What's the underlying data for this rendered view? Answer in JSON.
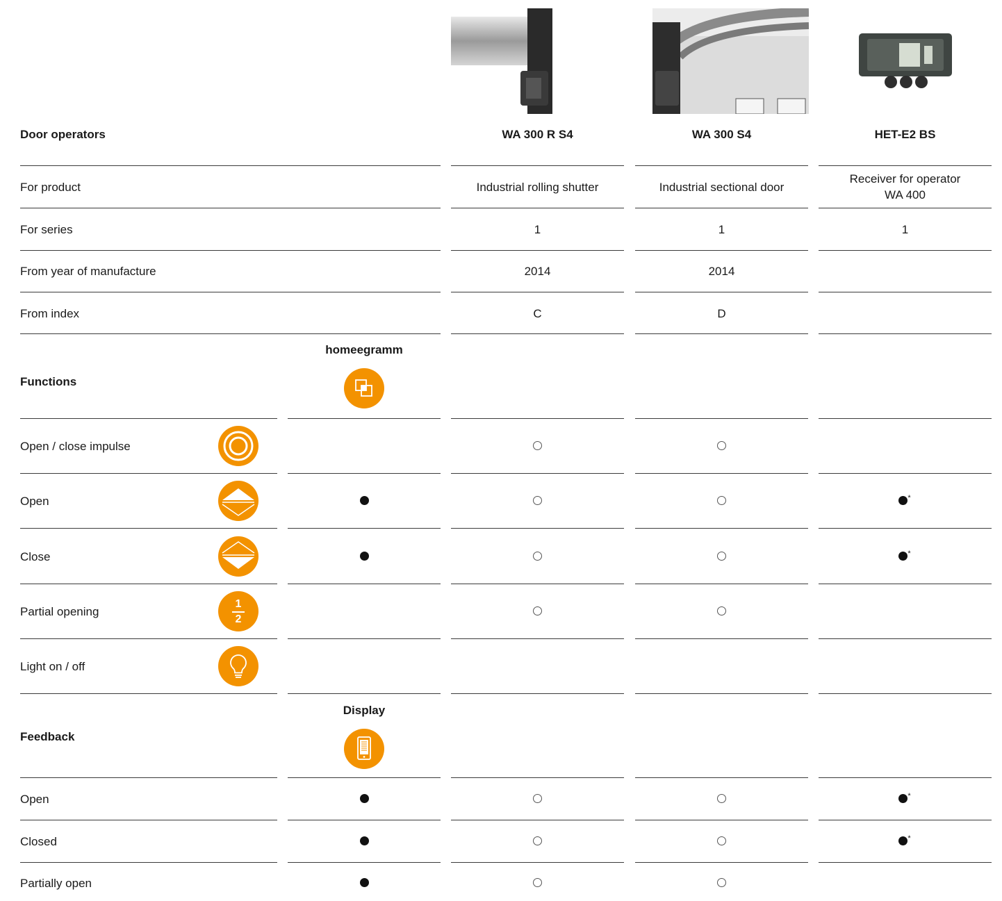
{
  "header": {
    "title": "Door operators",
    "products": [
      "WA 300 R S4",
      "WA 300 S4",
      "HET-E2 BS"
    ]
  },
  "specs": [
    {
      "label": "For product",
      "values": [
        "Industrial rolling shutter",
        "Industrial sectional door",
        "Receiver for operator WA 400"
      ]
    },
    {
      "label": "For series",
      "values": [
        "1",
        "1",
        "1"
      ]
    },
    {
      "label": "From year of manufacture",
      "values": [
        "2014",
        "2014",
        ""
      ]
    },
    {
      "label": "From index",
      "values": [
        "C",
        "D",
        ""
      ]
    }
  ],
  "receiver_lines": [
    "Receiver for operator",
    "WA 400"
  ],
  "functions": {
    "title": "Functions",
    "column_title": "homeegramm",
    "column_icon": "homeegramm-icon",
    "rows": [
      {
        "label": "Open / close impulse",
        "icon": "impulse-icon",
        "marks": [
          "",
          "open",
          "open",
          ""
        ]
      },
      {
        "label": "Open",
        "icon": "open-arrow-icon",
        "marks": [
          "filled",
          "open",
          "open",
          "filled*"
        ]
      },
      {
        "label": "Close",
        "icon": "close-arrow-icon",
        "marks": [
          "filled",
          "open",
          "open",
          "filled*"
        ]
      },
      {
        "label": "Partial opening",
        "icon": "half-icon",
        "marks": [
          "",
          "open",
          "open",
          ""
        ]
      },
      {
        "label": "Light on / off",
        "icon": "bulb-icon",
        "marks": [
          "",
          "",
          "",
          ""
        ]
      }
    ]
  },
  "feedback": {
    "title": "Feedback",
    "column_title": "Display",
    "column_icon": "display-icon",
    "rows": [
      {
        "label": "Open",
        "marks": [
          "filled",
          "open",
          "open",
          "filled*"
        ]
      },
      {
        "label": "Closed",
        "marks": [
          "filled",
          "open",
          "open",
          "filled*"
        ]
      },
      {
        "label": "Partially open",
        "marks": [
          "filled",
          "open",
          "open",
          ""
        ]
      }
    ]
  },
  "half_icon_text": {
    "top": "1",
    "bottom": "2"
  },
  "footnote_mark": "*",
  "colors": {
    "accent": "#f39200",
    "rule": "#3a3a3a"
  }
}
